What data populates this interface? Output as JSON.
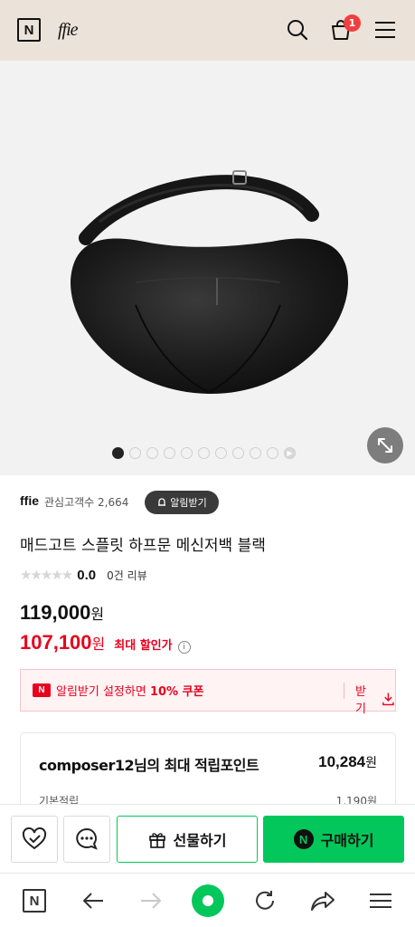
{
  "header": {
    "n_logo": "N",
    "brand_logo": "ffie",
    "cart_count": "1",
    "icons": [
      "search-icon",
      "cart-icon",
      "menu-icon"
    ]
  },
  "gallery": {
    "dot_count": 10,
    "active_index": 0,
    "has_video": true
  },
  "store": {
    "name": "ffie",
    "fans": "관심고객수 2,664",
    "notify_label": "알림받기"
  },
  "product": {
    "title": "매드고트 스플릿 하프문 메신저백 블랙",
    "rating_stars": 0,
    "rating": "0.0",
    "reviews": "0건 리뷰",
    "original_price": "119,000",
    "sale_price": "107,100",
    "won": "원",
    "sale_label": "최대 할인가"
  },
  "coupon": {
    "badge": "N",
    "text_prefix": "알림받기 설정하면 ",
    "text_bold": "10% 쿠폰",
    "get_label": "받기"
  },
  "points": {
    "title": "composer12님의 최대 적립포인트",
    "value": "10,284",
    "won": "원",
    "basic_label": "기본적립",
    "basic_value": "1,190원"
  },
  "buybar": {
    "gift_label": "선물하기",
    "buy_label": "구매하기",
    "buy_badge": "N"
  },
  "bottomnav": {
    "home_logo": "N"
  },
  "colors": {
    "header_bg": "#ebe3da",
    "naver_green": "#03c75a",
    "sale_red": "#e8001d",
    "badge_red": "#f03f3f"
  }
}
